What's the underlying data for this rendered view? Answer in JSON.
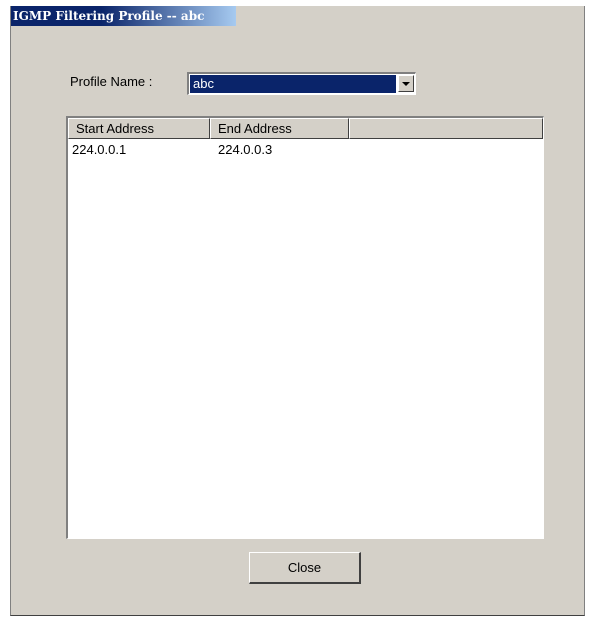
{
  "window": {
    "title": "IGMP Filtering Profile -- abc"
  },
  "form": {
    "profile_label": "Profile Name :",
    "profile_value": "abc"
  },
  "table": {
    "columns": [
      "Start Address",
      "End Address",
      ""
    ],
    "rows": [
      {
        "start": "224.0.0.1",
        "end": "224.0.0.3"
      }
    ]
  },
  "buttons": {
    "close_label": "Close"
  },
  "icons": {
    "dropdown": "chevron-down-icon"
  },
  "colors": {
    "title_bar": "#0a246a",
    "selection": "#0a246a",
    "window_bg": "#d4d0c8"
  }
}
